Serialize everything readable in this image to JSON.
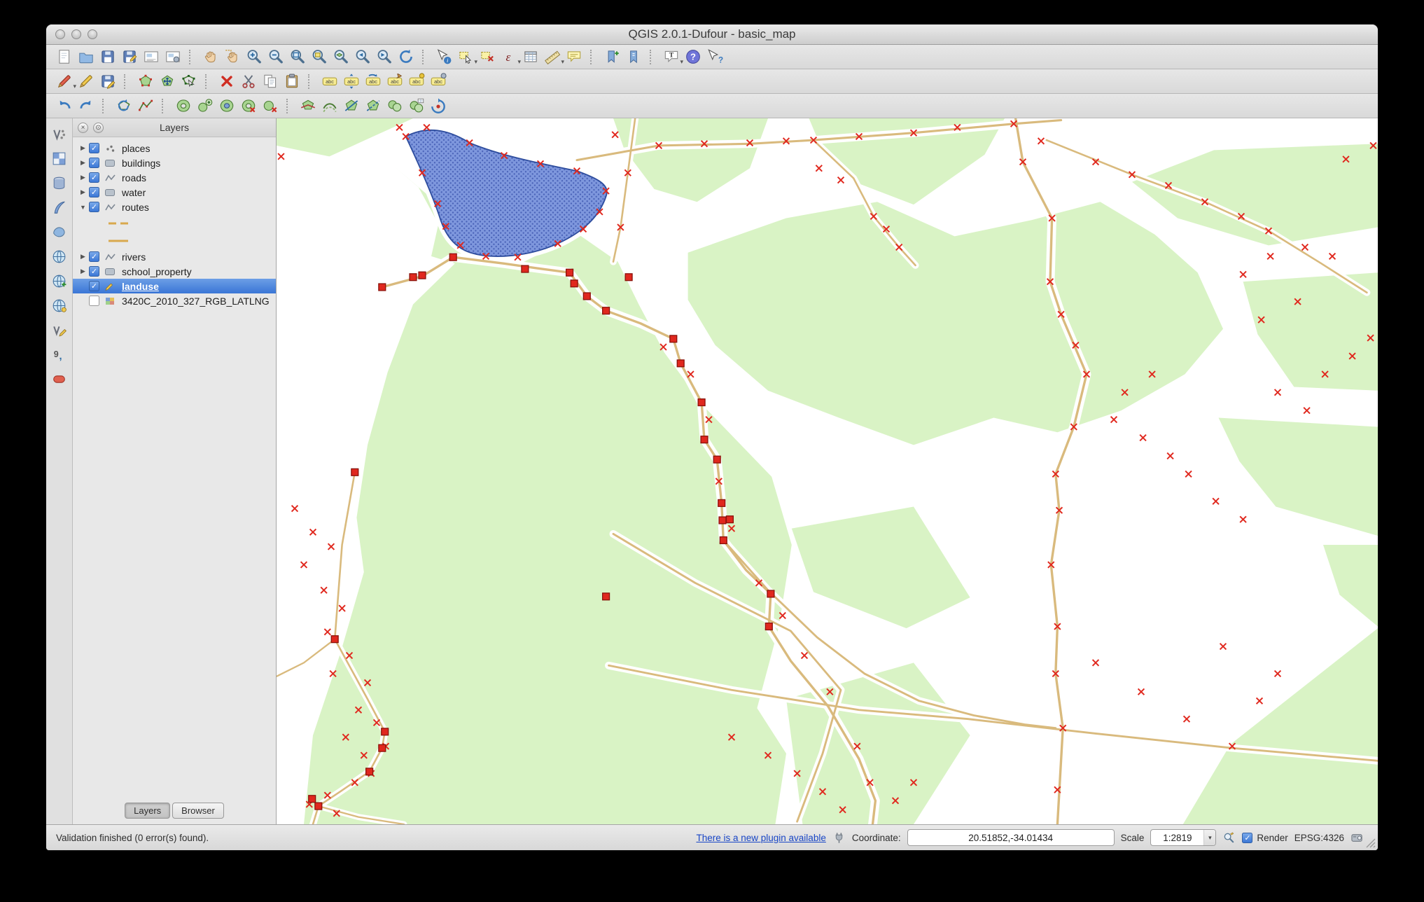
{
  "window": {
    "title": "QGIS 2.0.1-Dufour - basic_map"
  },
  "colors": {
    "selection_blue": "#3a76d6",
    "landuse_green": "#d9f3c5",
    "water_blue": "#7e97dd",
    "water_dot": "#4a63b8",
    "road_tan": "#d9ba7d",
    "marker_red": "#e0281e",
    "link_blue": "#1946c6"
  },
  "toolbars": {
    "main": [
      {
        "name": "new-project-button",
        "icon": "page"
      },
      {
        "name": "open-project-button",
        "icon": "folder"
      },
      {
        "name": "save-project-button",
        "icon": "floppy"
      },
      {
        "name": "save-project-as-button",
        "icon": "floppyAs"
      },
      {
        "name": "new-print-composer-button",
        "icon": "composer"
      },
      {
        "name": "composer-manager-button",
        "icon": "composerMgr"
      },
      {
        "sep": true
      },
      {
        "name": "pan-map-button",
        "icon": "hand"
      },
      {
        "name": "pan-to-selection-button",
        "icon": "handSel"
      },
      {
        "name": "zoom-in-button",
        "icon": "zoomIn"
      },
      {
        "name": "zoom-out-button",
        "icon": "zoomOut"
      },
      {
        "name": "zoom-full-button",
        "icon": "zoomFull"
      },
      {
        "name": "zoom-to-selection-button",
        "icon": "zoomSel"
      },
      {
        "name": "zoom-to-layer-button",
        "icon": "zoomLayer"
      },
      {
        "name": "zoom-last-button",
        "icon": "zoomLast"
      },
      {
        "name": "zoom-next-button",
        "icon": "zoomNext"
      },
      {
        "name": "refresh-map-button",
        "icon": "refresh"
      },
      {
        "sep": true
      },
      {
        "name": "identify-features-button",
        "icon": "identify"
      },
      {
        "name": "select-features-button",
        "icon": "selectTool",
        "dropdown": true
      },
      {
        "name": "deselect-features-button",
        "icon": "deselect"
      },
      {
        "name": "select-by-expression-button",
        "icon": "fieldCalc",
        "dropdown": true
      },
      {
        "name": "open-attribute-table-button",
        "icon": "attrTable"
      },
      {
        "name": "measure-button",
        "icon": "measure",
        "dropdown": true
      },
      {
        "name": "map-tips-button",
        "icon": "maptip"
      },
      {
        "sep": true
      },
      {
        "name": "new-bookmark-button",
        "icon": "bookmarkNew"
      },
      {
        "name": "show-bookmarks-button",
        "icon": "bookmarkShow"
      },
      {
        "sep": true
      },
      {
        "name": "text-annotation-button",
        "icon": "annotation",
        "dropdown": true
      },
      {
        "name": "help-button",
        "icon": "help"
      },
      {
        "name": "whats-this-button",
        "icon": "whatsThis"
      }
    ],
    "digitizing": [
      {
        "name": "current-edits-button",
        "icon": "pencilDrop",
        "dropdown": true
      },
      {
        "name": "toggle-editing-button",
        "icon": "pencilY"
      },
      {
        "name": "save-layer-edits-button",
        "icon": "floppyPencil"
      },
      {
        "sep": true
      },
      {
        "name": "add-feature-button",
        "icon": "capturePoly"
      },
      {
        "name": "move-feature-button",
        "icon": "moveFeat"
      },
      {
        "name": "node-tool-button",
        "icon": "nodeTool"
      },
      {
        "sep": true
      },
      {
        "name": "delete-selected-button",
        "icon": "redX"
      },
      {
        "name": "cut-features-button",
        "icon": "scissors"
      },
      {
        "name": "copy-features-button",
        "icon": "copy"
      },
      {
        "name": "paste-features-button",
        "icon": "paste"
      },
      {
        "sep": true
      },
      {
        "name": "layer-labeling-button",
        "icon": "abc"
      },
      {
        "name": "label-move-button",
        "icon": "abcMove"
      },
      {
        "name": "label-rotate-button",
        "icon": "abcRot"
      },
      {
        "name": "label-pin-button",
        "icon": "abcPin"
      },
      {
        "name": "label-highlight-button",
        "icon": "abcHl"
      },
      {
        "name": "label-properties-button",
        "icon": "abcProps"
      }
    ],
    "advanced": [
      {
        "name": "undo-button",
        "icon": "undoArr"
      },
      {
        "name": "redo-button",
        "icon": "redoArr"
      },
      {
        "sep": true
      },
      {
        "name": "rotate-features-button",
        "icon": "rotFeat"
      },
      {
        "name": "simplify-feature-button",
        "icon": "simplify"
      },
      {
        "sep": true
      },
      {
        "name": "add-ring-button",
        "icon": "ring"
      },
      {
        "name": "add-part-button",
        "icon": "addPart"
      },
      {
        "name": "fill-ring-button",
        "icon": "fillRing"
      },
      {
        "name": "delete-ring-button",
        "icon": "delRing"
      },
      {
        "name": "delete-part-button",
        "icon": "delPart"
      },
      {
        "sep": true
      },
      {
        "name": "reshape-features-button",
        "icon": "reshape"
      },
      {
        "name": "offset-curve-button",
        "icon": "offset"
      },
      {
        "name": "split-features-button",
        "icon": "splitF"
      },
      {
        "name": "split-parts-button",
        "icon": "splitP"
      },
      {
        "name": "merge-features-button",
        "icon": "merge"
      },
      {
        "name": "merge-attributes-button",
        "icon": "mergeAttr"
      },
      {
        "name": "rotate-point-symbols-button",
        "icon": "rotPoint"
      }
    ],
    "sidebar": [
      {
        "name": "add-vector-layer-button",
        "icon": "vLayer"
      },
      {
        "name": "add-raster-layer-button",
        "icon": "rasterIcon"
      },
      {
        "name": "add-postgis-layer-button",
        "icon": "dbLayer"
      },
      {
        "name": "add-spatialite-layer-button",
        "icon": "spatialite"
      },
      {
        "name": "add-mssql-layer-button",
        "icon": "mssqlBlob"
      },
      {
        "name": "add-wms-layer-button",
        "icon": "globe"
      },
      {
        "name": "add-wcs-layer-button",
        "icon": "globe2"
      },
      {
        "name": "add-wfs-layer-button",
        "icon": "globe3"
      },
      {
        "name": "new-shapefile-layer-button",
        "icon": "vNew"
      },
      {
        "name": "add-delimited-text-layer-button",
        "icon": "commaIcon"
      },
      {
        "name": "add-oracle-layer-button",
        "icon": "oracleIcon"
      }
    ]
  },
  "panel": {
    "title": "Layers",
    "tabs": [
      {
        "label": "Layers",
        "active": true
      },
      {
        "label": "Browser",
        "active": false
      }
    ],
    "layers": [
      {
        "label": "places",
        "checked": true,
        "expander": "collapsed",
        "type": "point"
      },
      {
        "label": "buildings",
        "checked": true,
        "expander": "collapsed",
        "type": "polygon"
      },
      {
        "label": "roads",
        "checked": true,
        "expander": "collapsed",
        "type": "line"
      },
      {
        "label": "water",
        "checked": true,
        "expander": "collapsed",
        "type": "polygon"
      },
      {
        "label": "routes",
        "checked": true,
        "expander": "expanded",
        "type": "line"
      },
      {
        "swatch": "dashed"
      },
      {
        "swatch": "solid"
      },
      {
        "label": "rivers",
        "checked": true,
        "expander": "collapsed",
        "type": "line"
      },
      {
        "label": "school_property",
        "checked": true,
        "expander": "collapsed",
        "type": "polygon"
      },
      {
        "label": "landuse",
        "checked": true,
        "type": "edit",
        "selected": true
      },
      {
        "label": "3420C_2010_327_RGB_LATLNG",
        "checked": false,
        "type": "raster"
      }
    ]
  },
  "statusbar": {
    "validation": "Validation finished (0 error(s) found).",
    "plugin_link": "There is a new plugin available",
    "coordinate_label": "Coordinate:",
    "coordinate_value": "20.51852,-34.01434",
    "scale_label": "Scale",
    "scale_value": "1:2819",
    "render_label": "Render",
    "crs": "EPSG:4326"
  }
}
